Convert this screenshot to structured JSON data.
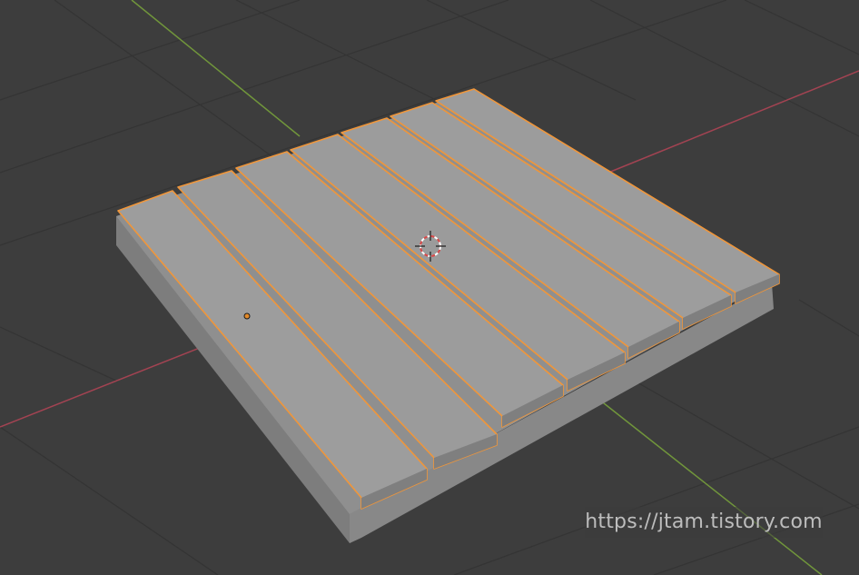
{
  "watermark": {
    "text": "https://jtam.tistory.com"
  },
  "colors": {
    "background": "#3d3d3d",
    "grid_line": "#333333",
    "x_axis": "#a34352",
    "y_axis": "#71963b",
    "selection_outline": "#f0963a",
    "plank_top": "#9c9c9c",
    "plank_side": "#828282",
    "base_side": "#8a8a8a",
    "cursor_red": "#d94848",
    "cursor_white": "#ffffff",
    "origin_dot": "#e38a2a"
  },
  "icons": {
    "cursor": "3d-cursor-icon",
    "origin": "object-origin-icon"
  }
}
